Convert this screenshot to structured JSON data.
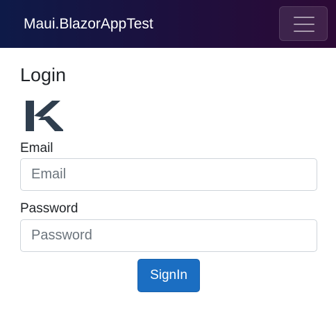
{
  "navbar": {
    "title": "Maui.BlazorAppTest",
    "toggler_icon": "hamburger-icon"
  },
  "page": {
    "title": "Login",
    "logo_icon": "k-logo-icon"
  },
  "form": {
    "email_label": "Email",
    "email_placeholder": "Email",
    "email_value": "",
    "password_label": "Password",
    "password_placeholder": "Password",
    "password_value": "",
    "submit_label": "SignIn"
  },
  "colors": {
    "navbar_gradient_start": "#0e1a48",
    "navbar_gradient_end": "#2d0a36",
    "primary_button": "#1b6ec2",
    "logo": "#2f3e4e"
  }
}
